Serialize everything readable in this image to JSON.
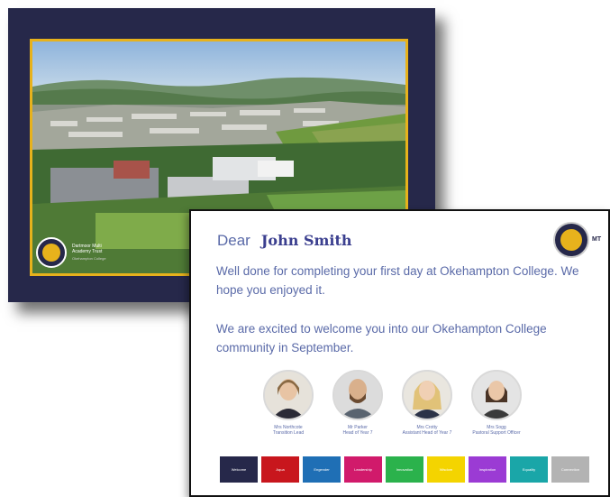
{
  "back_card": {
    "school": {
      "trust_name": "Dartmoor Multi Academy Trust",
      "tagline": "Okehampton College"
    }
  },
  "front_card": {
    "greeting": "Dear",
    "recipient_name": "John Smith",
    "logo_text": "MT",
    "message_1": "Well done for completing your first day at Okehampton College.  We hope you enjoyed it.",
    "message_2": "We are excited to welcome you into our Okehampton College community in September.",
    "staff": [
      {
        "name": "Mrs Northcote",
        "role": "Transition Lead"
      },
      {
        "name": "Mr Parker",
        "role": "Head of Year 7"
      },
      {
        "name": "Mrs Crotty",
        "role": "Assistant Head of Year 7"
      },
      {
        "name": "Mrs Sogg",
        "role": "Pastoral Support Officer"
      }
    ],
    "tiles": [
      {
        "label": "Welcome",
        "color": "#26284a"
      },
      {
        "label": "Aqua",
        "color": "#c8161d"
      },
      {
        "label": "Engender",
        "color": "#1f6fb5"
      },
      {
        "label": "Leadership",
        "color": "#d11a6b"
      },
      {
        "label": "Innovation",
        "color": "#2bb24c"
      },
      {
        "label": "Wisdom",
        "color": "#f4d400"
      },
      {
        "label": "Inspiration",
        "color": "#9b3bd4"
      },
      {
        "label": "Equality",
        "color": "#1aa6a8"
      },
      {
        "label": "Connection",
        "color": "#b3b3b3"
      }
    ]
  },
  "colors": {
    "navy": "#26284a",
    "gold": "#e7b21c",
    "text_blue": "#5a6aa8"
  }
}
